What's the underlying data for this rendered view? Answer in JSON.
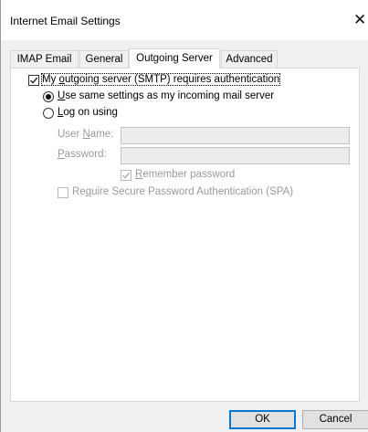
{
  "window": {
    "title": "Internet Email Settings",
    "close_label": "✕"
  },
  "tabs": [
    {
      "label": "IMAP Email",
      "active": false
    },
    {
      "label": "General",
      "active": false
    },
    {
      "label": "Outgoing Server",
      "active": true
    },
    {
      "label": "Advanced",
      "active": false
    }
  ],
  "outgoing": {
    "auth_checkbox": {
      "prefix": "My ",
      "accel": "o",
      "suffix": "utgoing server (SMTP) requires authentication",
      "checked": true
    },
    "use_same": {
      "accel": "U",
      "suffix": "se same settings as my incoming mail server",
      "selected": true
    },
    "log_on": {
      "accel": "L",
      "suffix": "og on using",
      "selected": false
    },
    "user_name": {
      "prefix": "User ",
      "accel": "N",
      "suffix": "ame:",
      "value": ""
    },
    "password": {
      "accel": "P",
      "suffix": "assword:",
      "value": ""
    },
    "remember_password": {
      "accel": "R",
      "suffix": "emember password",
      "checked": true,
      "disabled": true
    },
    "spa": {
      "prefix": "Re",
      "accel": "q",
      "suffix": "uire Secure Password Authentication (SPA)",
      "checked": false,
      "disabled": true
    }
  },
  "footer": {
    "ok_label": "OK",
    "cancel_label": "Cancel"
  },
  "colors": {
    "panel_bg": "#ffffff",
    "dialog_bg": "#f0f0f0",
    "disabled_text": "#9a9a9a",
    "default_button_border": "#0078d7"
  },
  "icons": {
    "close": "close-icon",
    "checkmark": "checkmark-icon",
    "radio_dot": "radio-dot-icon"
  }
}
